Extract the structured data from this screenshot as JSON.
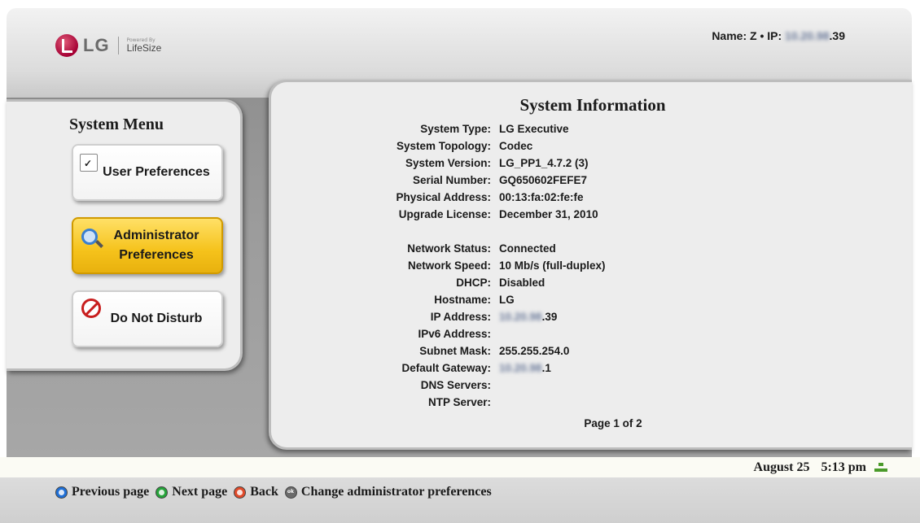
{
  "header": {
    "brand_name": "LG",
    "powered_by": "Powered By",
    "partner_name": "LifeSize",
    "name_label": "Name:",
    "name_value": "Z",
    "ip_label": "IP:",
    "ip_prefix_hidden": "10.20.98",
    "ip_suffix": ".39"
  },
  "menu": {
    "title": "System Menu",
    "items": [
      {
        "label": "User Preferences",
        "selected": false,
        "icon": "document-check-icon"
      },
      {
        "label": "Administrator Preferences",
        "selected": true,
        "icon": "magnifier-icon"
      },
      {
        "label": "Do Not Disturb",
        "selected": false,
        "icon": "no-phone-icon"
      }
    ]
  },
  "info": {
    "title": "System Information",
    "rows": [
      {
        "label": "System Type:",
        "value": "LG Executive"
      },
      {
        "label": "System Topology:",
        "value": "Codec"
      },
      {
        "label": "System Version:",
        "value": "LG_PP1_4.7.2 (3)"
      },
      {
        "label": "Serial Number:",
        "value": "GQ650602FEFE7"
      },
      {
        "label": "Physical Address:",
        "value": "00:13:fa:02:fe:fe"
      },
      {
        "label": "Upgrade License:",
        "value": "December 31, 2010"
      },
      {
        "label": "Network Status:",
        "value": "Connected"
      },
      {
        "label": "Network Speed:",
        "value": "10 Mb/s (full-duplex)"
      },
      {
        "label": "DHCP:",
        "value": "Disabled"
      },
      {
        "label": "Hostname:",
        "value": "LG"
      },
      {
        "label": "IP Address:",
        "value_hidden": "10.20.98",
        "value": ".39"
      },
      {
        "label": "IPv6 Address:",
        "value": ""
      },
      {
        "label": "Subnet Mask:",
        "value": "255.255.254.0"
      },
      {
        "label": "Default Gateway:",
        "value_hidden": "10.20.98",
        "value": ".1"
      },
      {
        "label": "DNS Servers:",
        "value": ""
      },
      {
        "label": "NTP Server:",
        "value": ""
      }
    ],
    "page_indicator": "Page 1 of 2"
  },
  "status": {
    "date": "August 25",
    "time": "5:13 pm"
  },
  "hints": [
    {
      "key": "blue",
      "label": "Previous page"
    },
    {
      "key": "green",
      "label": "Next page"
    },
    {
      "key": "red",
      "label": "Back"
    },
    {
      "key": "ok",
      "label": "Change administrator preferences"
    }
  ],
  "colors": {
    "selected_button": "#f5c21b",
    "panel_bg": "#ededed",
    "frame_gray": "#9c9c9c",
    "brand_red": "#a50034"
  }
}
